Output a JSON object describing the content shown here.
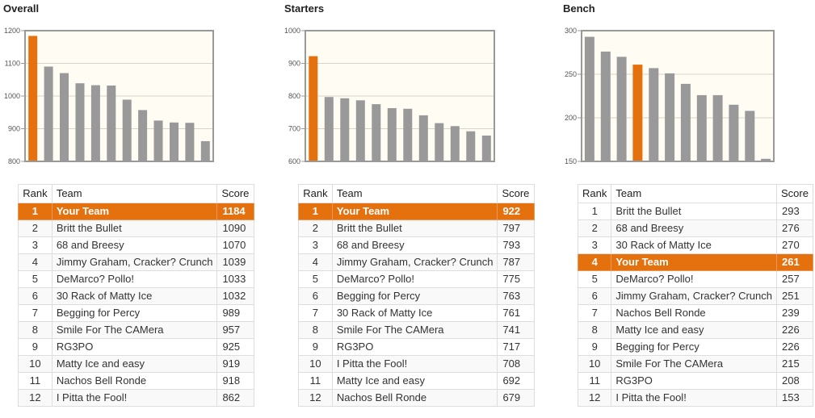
{
  "colors": {
    "highlight": "#e5700e",
    "bar": "#999999",
    "plot_background": "#fffcf4",
    "gridline": "#d8d4c8",
    "axis": "#999999"
  },
  "table_headers": {
    "rank": "Rank",
    "team": "Team",
    "score": "Score"
  },
  "chart_data": [
    {
      "type": "bar",
      "title": "Overall",
      "xlabel": "",
      "ylabel": "",
      "ylim": [
        800,
        1200
      ],
      "yticks": [
        800,
        900,
        1000,
        1100,
        1200
      ],
      "grid": true,
      "highlight_index": 0,
      "categories": [
        "Your Team",
        "Britt the Bullet",
        "68 and Breesy",
        "Jimmy Graham, Cracker? Crunch",
        "DeMarco? Pollo!",
        "30 Rack of Matty Ice",
        "Begging for Percy",
        "Smile For The CAMera",
        "RG3PO",
        "Matty Ice and easy",
        "Nachos Bell Ronde",
        "I Pitta the Fool!"
      ],
      "values": [
        1184,
        1090,
        1070,
        1039,
        1033,
        1032,
        989,
        957,
        925,
        919,
        918,
        862
      ]
    },
    {
      "type": "bar",
      "title": "Starters",
      "xlabel": "",
      "ylabel": "",
      "ylim": [
        600,
        1000
      ],
      "yticks": [
        600,
        700,
        800,
        900,
        1000
      ],
      "grid": true,
      "highlight_index": 0,
      "categories": [
        "Your Team",
        "Britt the Bullet",
        "68 and Breesy",
        "Jimmy Graham, Cracker? Crunch",
        "DeMarco? Pollo!",
        "Begging for Percy",
        "30 Rack of Matty Ice",
        "Smile For The CAMera",
        "RG3PO",
        "I Pitta the Fool!",
        "Matty Ice and easy",
        "Nachos Bell Ronde"
      ],
      "values": [
        922,
        797,
        793,
        787,
        775,
        763,
        761,
        741,
        717,
        708,
        692,
        679
      ]
    },
    {
      "type": "bar",
      "title": "Bench",
      "xlabel": "",
      "ylabel": "",
      "ylim": [
        150,
        300
      ],
      "yticks": [
        150,
        200,
        250,
        300
      ],
      "grid": true,
      "highlight_index": 3,
      "categories": [
        "Britt the Bullet",
        "68 and Breesy",
        "30 Rack of Matty Ice",
        "Your Team",
        "DeMarco? Pollo!",
        "Jimmy Graham, Cracker? Crunch",
        "Nachos Bell Ronde",
        "Matty Ice and easy",
        "Begging for Percy",
        "Smile For The CAMera",
        "RG3PO",
        "I Pitta the Fool!"
      ],
      "values": [
        293,
        276,
        270,
        261,
        257,
        251,
        239,
        226,
        226,
        215,
        208,
        153
      ]
    }
  ],
  "tables": [
    {
      "name": "overall",
      "rows": [
        {
          "rank": "1",
          "team": "Your Team",
          "score": "1184",
          "highlight": true
        },
        {
          "rank": "2",
          "team": "Britt the Bullet",
          "score": "1090"
        },
        {
          "rank": "3",
          "team": "68 and Breesy",
          "score": "1070"
        },
        {
          "rank": "4",
          "team": "Jimmy Graham, Cracker? Crunch",
          "score": "1039"
        },
        {
          "rank": "5",
          "team": "DeMarco? Pollo!",
          "score": "1033"
        },
        {
          "rank": "6",
          "team": "30 Rack of Matty Ice",
          "score": "1032"
        },
        {
          "rank": "7",
          "team": "Begging for Percy",
          "score": "989"
        },
        {
          "rank": "8",
          "team": "Smile For The CAMera",
          "score": "957"
        },
        {
          "rank": "9",
          "team": "RG3PO",
          "score": "925"
        },
        {
          "rank": "10",
          "team": "Matty Ice and easy",
          "score": "919"
        },
        {
          "rank": "11",
          "team": "Nachos Bell Ronde",
          "score": "918"
        },
        {
          "rank": "12",
          "team": "I Pitta the Fool!",
          "score": "862"
        }
      ]
    },
    {
      "name": "starters",
      "rows": [
        {
          "rank": "1",
          "team": "Your Team",
          "score": "922",
          "highlight": true
        },
        {
          "rank": "2",
          "team": "Britt the Bullet",
          "score": "797"
        },
        {
          "rank": "3",
          "team": "68 and Breesy",
          "score": "793"
        },
        {
          "rank": "4",
          "team": "Jimmy Graham, Cracker? Crunch",
          "score": "787"
        },
        {
          "rank": "5",
          "team": "DeMarco? Pollo!",
          "score": "775"
        },
        {
          "rank": "6",
          "team": "Begging for Percy",
          "score": "763"
        },
        {
          "rank": "7",
          "team": "30 Rack of Matty Ice",
          "score": "761"
        },
        {
          "rank": "8",
          "team": "Smile For The CAMera",
          "score": "741"
        },
        {
          "rank": "9",
          "team": "RG3PO",
          "score": "717"
        },
        {
          "rank": "10",
          "team": "I Pitta the Fool!",
          "score": "708"
        },
        {
          "rank": "11",
          "team": "Matty Ice and easy",
          "score": "692"
        },
        {
          "rank": "12",
          "team": "Nachos Bell Ronde",
          "score": "679"
        }
      ]
    },
    {
      "name": "bench",
      "rows": [
        {
          "rank": "1",
          "team": "Britt the Bullet",
          "score": "293"
        },
        {
          "rank": "2",
          "team": "68 and Breesy",
          "score": "276"
        },
        {
          "rank": "3",
          "team": "30 Rack of Matty Ice",
          "score": "270"
        },
        {
          "rank": "4",
          "team": "Your Team",
          "score": "261",
          "highlight": true
        },
        {
          "rank": "5",
          "team": "DeMarco? Pollo!",
          "score": "257"
        },
        {
          "rank": "6",
          "team": "Jimmy Graham, Cracker? Crunch",
          "score": "251"
        },
        {
          "rank": "7",
          "team": "Nachos Bell Ronde",
          "score": "239"
        },
        {
          "rank": "8",
          "team": "Matty Ice and easy",
          "score": "226"
        },
        {
          "rank": "9",
          "team": "Begging for Percy",
          "score": "226"
        },
        {
          "rank": "10",
          "team": "Smile For The CAMera",
          "score": "215"
        },
        {
          "rank": "11",
          "team": "RG3PO",
          "score": "208"
        },
        {
          "rank": "12",
          "team": "I Pitta the Fool!",
          "score": "153"
        }
      ]
    }
  ]
}
